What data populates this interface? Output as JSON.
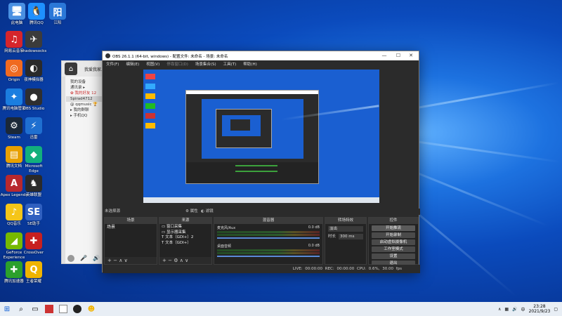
{
  "desktop_icons": [
    {
      "label": "此电脑",
      "glyph": "🖥",
      "color": "#4a90e2"
    },
    {
      "label": "腾讯QQ",
      "glyph": "🐧",
      "color": "#1e90ff"
    },
    {
      "label": "江阳",
      "glyph": "阳",
      "color": "#2b78d8"
    },
    {
      "label": "网易云音乐",
      "glyph": "♫",
      "color": "#d6252b"
    },
    {
      "label": "shadowsocks",
      "glyph": "✈",
      "color": "#3b3b3b"
    },
    {
      "label": "Origin",
      "glyph": "◎",
      "color": "#f06a20"
    },
    {
      "label": "夜神模拟器",
      "glyph": "◐",
      "color": "#2a2a2a"
    },
    {
      "label": "腾讯电脑管家",
      "glyph": "✦",
      "color": "#1b7ee0"
    },
    {
      "label": "OBS Studio",
      "glyph": "●",
      "color": "#2f2f2f"
    },
    {
      "label": "Steam",
      "glyph": "⚙",
      "color": "#1b2838"
    },
    {
      "label": "迅雷",
      "glyph": "⚡",
      "color": "#1f6fd0"
    },
    {
      "label": "腾讯文档",
      "glyph": "▤",
      "color": "#e8a000"
    },
    {
      "label": "Microsoft Edge",
      "glyph": "◆",
      "color": "#12b07c"
    },
    {
      "label": "Apex Legends",
      "glyph": "A",
      "color": "#b8282e"
    },
    {
      "label": "英雄联盟",
      "glyph": "♞",
      "color": "#2a2a2a"
    },
    {
      "label": "QQ音乐",
      "glyph": "♪",
      "color": "#f5c518"
    },
    {
      "label": "SE助手",
      "glyph": "SE",
      "color": "#3060c0"
    },
    {
      "label": "GeForce Experience",
      "glyph": "◢",
      "color": "#76b900"
    },
    {
      "label": "CrossOver",
      "glyph": "✚",
      "color": "#c72020"
    },
    {
      "label": "腾讯加速器",
      "glyph": "✚",
      "color": "#2ca02c"
    },
    {
      "label": "王者荣耀",
      "glyph": "Q",
      "color": "#f0b400"
    }
  ],
  "qq": {
    "title": "我爱我家人",
    "rows": [
      "我的设备",
      "通讯录 ▸",
      "✿ 我的好友 12",
      "Spirad4712",
      "@ qqmusic 🏆",
      "▸ 我的群聊",
      "▸ 手机QQ"
    ]
  },
  "obs": {
    "title": "OBS 26.1.1 (64-bit, windows) - 配置文件: 未命名 - 场景: 未命名",
    "menu": [
      "文件(F)",
      "编辑(E)",
      "视图(V)",
      "停靠窗口(D)",
      "场景集合(S)",
      "工具(T)",
      "帮助(H)"
    ],
    "preview_bar": {
      "no_source": "未选择源",
      "properties": "属性",
      "filters": "滤镜"
    },
    "docks": {
      "scenes": {
        "header": "场景",
        "items": [
          "场景"
        ]
      },
      "sources": {
        "header": "来源",
        "items": [
          "窗口采集",
          "显示器采集",
          "文本（GDI+）2",
          "文本（GDI+）"
        ]
      },
      "mixer": {
        "header": "混音器",
        "tracks": [
          {
            "name": "麦克风/Aux",
            "db": "0.0 dB"
          },
          {
            "name": "桌面音频",
            "db": "0.0 dB"
          }
        ]
      },
      "transitions": {
        "header": "转场特效",
        "type": "淡出",
        "duration_label": "时长",
        "duration": "300 ms"
      },
      "controls": {
        "header": "控件",
        "buttons": [
          "开始推流",
          "开始录制",
          "启动虚拟摄像机",
          "工作室模式",
          "设置",
          "退出"
        ]
      }
    },
    "status": {
      "live": "LIVE: 00:00:00",
      "rec": "REC: 00:00:00",
      "cpu": "CPU: 0.6%, 30.00 fps"
    }
  },
  "taskbar": {
    "time": "23:28",
    "date": "2021/9/23"
  }
}
